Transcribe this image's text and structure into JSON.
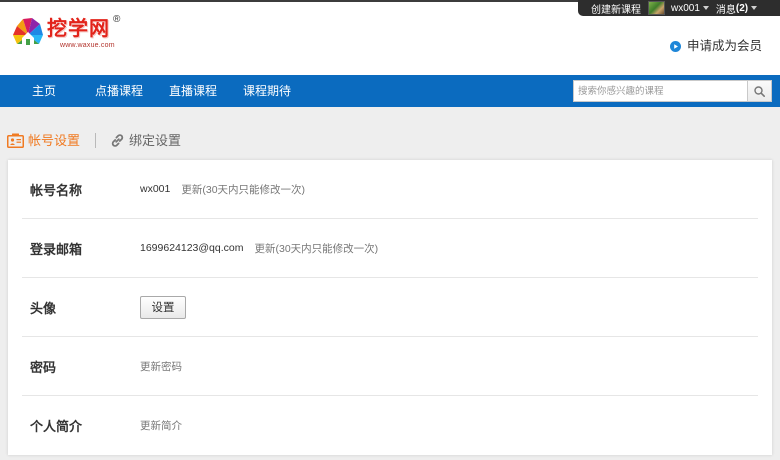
{
  "topbar": {
    "create_course": "创建新课程",
    "username": "wx001",
    "messages_label": "消息",
    "messages_count": "(2)"
  },
  "logo": {
    "name": "挖学网",
    "registered_mark": "®",
    "url_text": "www.waxue.com"
  },
  "header": {
    "apply_member": "申请成为会员"
  },
  "nav": {
    "items": [
      {
        "label": "主页"
      },
      {
        "label": "点播课程"
      },
      {
        "label": "直播课程"
      },
      {
        "label": "课程期待"
      }
    ],
    "search_placeholder": "搜索你感兴趣的课程"
  },
  "tabs": {
    "account": "帐号设置",
    "bind": "绑定设置"
  },
  "settings": {
    "username": {
      "label": "帐号名称",
      "value": "wx001",
      "action": "更新(30天内只能修改一次)"
    },
    "email": {
      "label": "登录邮箱",
      "value": "1699624123@qq.com",
      "action": "更新(30天内只能修改一次)"
    },
    "avatar": {
      "label": "头像",
      "button": "设置"
    },
    "password": {
      "label": "密码",
      "action": "更新密码"
    },
    "bio": {
      "label": "个人简介",
      "action": "更新简介"
    }
  },
  "colors": {
    "nav_bg": "#0b6bbf",
    "accent": "#f07a22",
    "topbar_bg": "#2d2d2d",
    "logo_red": "#e2231a",
    "page_bg": "#eeeeee"
  },
  "icons": {
    "logo": "house-logo-icon",
    "apply": "play-circle-icon",
    "search": "search-icon",
    "account_tab": "id-card-icon",
    "bind_tab": "link-icon",
    "dropdown": "caret-down-icon",
    "avatar": "user-avatar"
  }
}
